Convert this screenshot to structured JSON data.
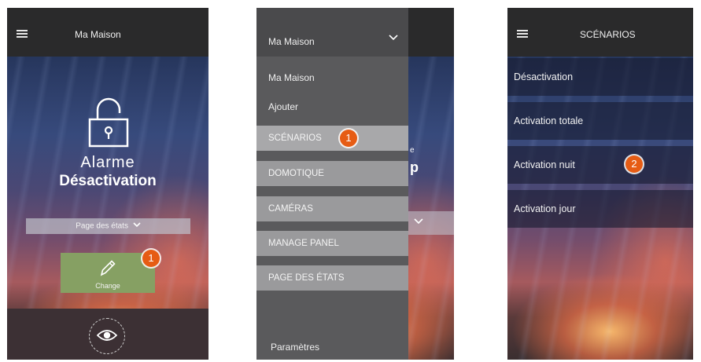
{
  "panel1": {
    "title": "Ma Maison",
    "alarm_label": "Alarme",
    "alarm_state": "Désactivation",
    "status_page_dropdown": "Page des états",
    "change_button_label": "Change",
    "badge": "1"
  },
  "panel2": {
    "house_selector": "Ma Maison",
    "house_item": "Ma Maison",
    "add_item": "Ajouter",
    "menu_items": [
      "SCÉNARIOS",
      "DOMOTIQUE",
      "CAMÉRAS",
      "MANAGE PANEL",
      "PAGE DES ÉTATS"
    ],
    "settings": "Paramètres",
    "badge": "1"
  },
  "panel3": {
    "title": "SCÉNARIOS",
    "scenarios": [
      "Désactivation",
      "Activation totale",
      "Activation nuit",
      "Activation jour"
    ],
    "badge": "2"
  },
  "colors": {
    "accent_badge": "#e65c14",
    "change_button": "#86a063",
    "menu_item_bg": "#9a9a9c",
    "topbar": "#2a2a2b"
  }
}
